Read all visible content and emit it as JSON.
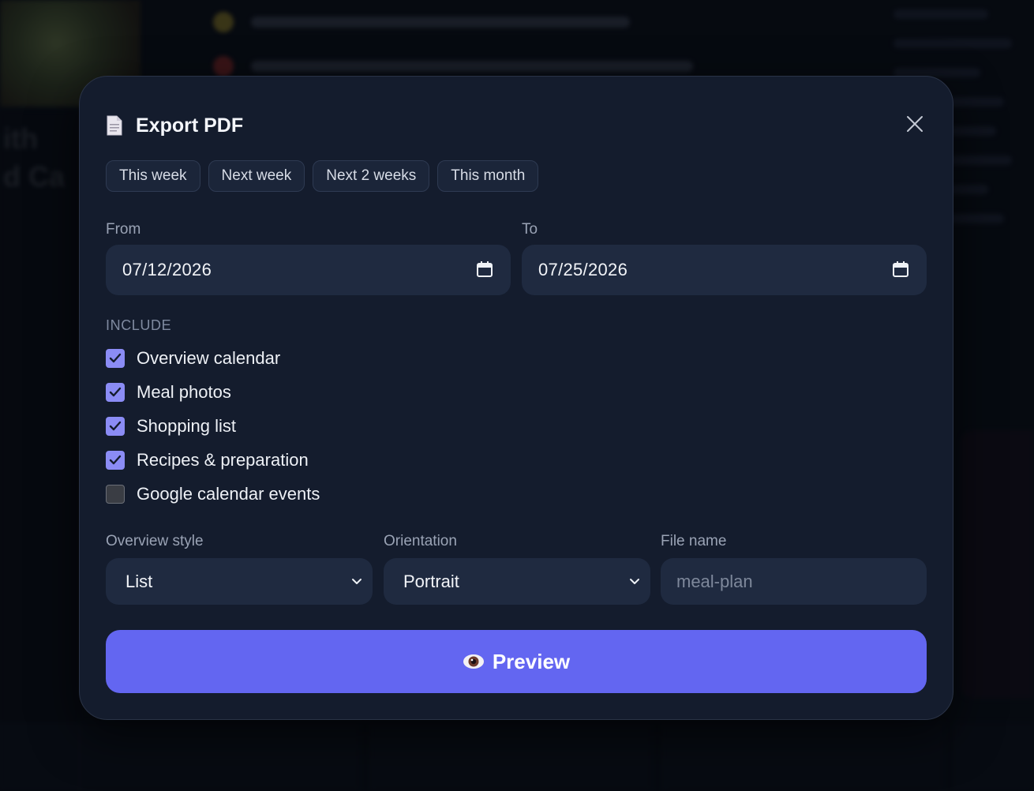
{
  "dialog": {
    "title": "Export PDF",
    "close_icon": "close-icon",
    "doc_icon": "document-icon"
  },
  "presets": [
    "This week",
    "Next week",
    "Next 2 weeks",
    "This month"
  ],
  "date_range": {
    "from_label": "From",
    "from_value": "07/12/2026",
    "to_label": "To",
    "to_value": "07/25/2026"
  },
  "include": {
    "label": "INCLUDE",
    "options": [
      {
        "label": "Overview calendar",
        "checked": true
      },
      {
        "label": "Meal photos",
        "checked": true
      },
      {
        "label": "Shopping list",
        "checked": true
      },
      {
        "label": "Recipes & preparation",
        "checked": true
      },
      {
        "label": "Google calendar events",
        "checked": false
      }
    ]
  },
  "settings": {
    "style_label": "Overview style",
    "style_value": "List",
    "orientation_label": "Orientation",
    "orientation_value": "Portrait",
    "filename_label": "File name",
    "filename_placeholder": "meal-plan"
  },
  "preview_button": {
    "label": "Preview",
    "icon": "eye-icon"
  },
  "colors": {
    "accent": "#6366f1",
    "checkbox_on": "#8b8cf5",
    "modal_bg": "#141c2d",
    "input_bg": "#1f2a40"
  }
}
